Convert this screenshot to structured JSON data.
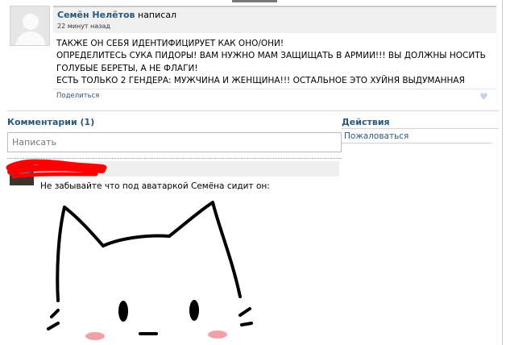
{
  "post": {
    "author_name": "Семён Нелётов",
    "action": "написал",
    "time": "22 минут назад",
    "lines": [
      "ТАКЖЕ ОН СЕБЯ ИДЕНТИФИЦИРУЕТ КАК ОНО/ОНИ!",
      "ОПРЕДЕЛИТЕСЬ СУКА ПИДОРЫ! ВАМ НУЖНО МАМ ЗАЩИЩАТЬ В АРМИИ!!! ВЫ ДОЛЖНЫ НОСИТЬ",
      "ГОЛУБЫЕ БЕРЕТЫ, А НЕ ФЛАГИ!",
      "ЕСТЬ ТОЛЬКО 2 ГЕНДЕРА: МУЖЧИНА И ЖЕНЩИНА!!! ОСТАЛЬНОЕ ЭТО ХУЙНЯ ВЫДУМАННАЯ"
    ],
    "share_label": "Поделиться",
    "like_icon": "heart-icon"
  },
  "comments": {
    "title": "Комментарии (1)",
    "input_placeholder": "Написать",
    "items": [
      {
        "text": "Не забывайте что под аватаркой Семёна сидит он:"
      }
    ]
  },
  "actions": {
    "title": "Действия",
    "report_label": "Пожаловаться"
  },
  "colors": {
    "link": "#2b587a",
    "header_bg": "#f0f0f0",
    "redaction": "#ff0000",
    "blush": "#f2a0a8"
  }
}
